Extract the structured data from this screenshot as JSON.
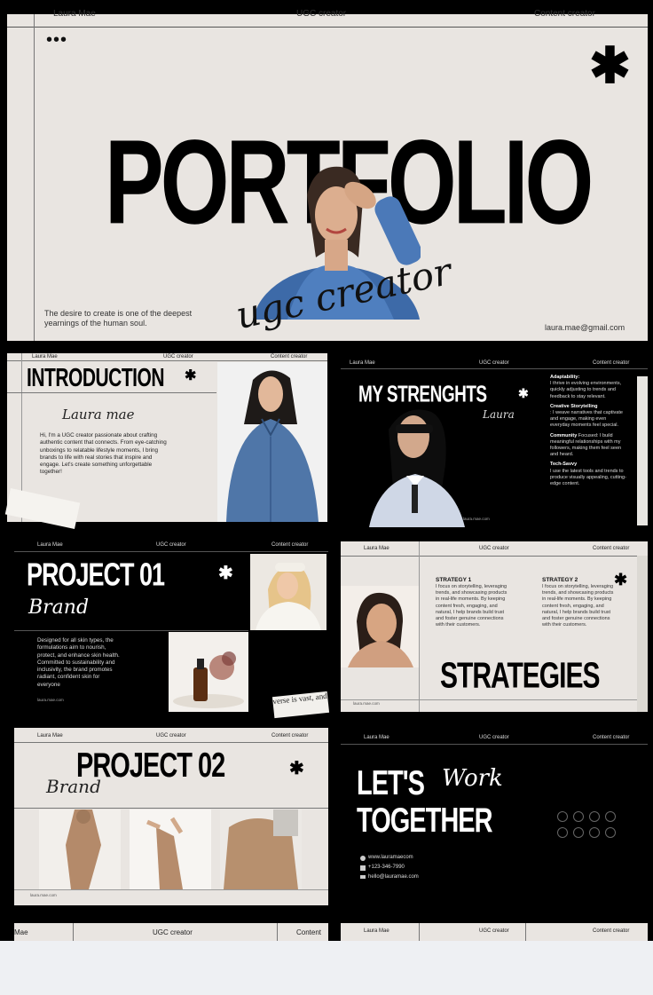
{
  "cover": {
    "header_left": "Laura Mae",
    "header_mid": "UGC creator",
    "header_right": "Content creator",
    "dots": "•••",
    "star": "✱",
    "title": "PORTFOLIO",
    "signature": "ugc creator",
    "tagline": "The desire to create is one of the deepest yearnings of the human soul.",
    "email": "laura.mae@gmail.com"
  },
  "intro": {
    "header_left": "Laura Mae",
    "header_mid": "UGC creator",
    "header_right": "Content creator",
    "title": "INTRODUCTION",
    "star": "✱",
    "signature": "Laura mae",
    "body": "Hi, I'm a UGC creator passionate about crafting authentic content that connects. From eye-catching unboxings to relatable lifestyle moments, I bring brands to life with real stories that inspire and engage. Let's create something unforgettable together!"
  },
  "strengths": {
    "header_left": "Laura Mae",
    "header_mid": "UGC creator",
    "header_right": "Content creator",
    "title": "MY STRENGHTS",
    "star": "✱",
    "signature": "Laura",
    "website": "laura.mae.com",
    "items": [
      {
        "name": "Adaptability:",
        "text": "I thrive in evolving environments, quickly adjusting to trends and feedback to stay relevant."
      },
      {
        "name": "Creative Storytelling",
        "text": ": I weave narratives that captivate and engage, making even everyday moments feel special."
      },
      {
        "name": "Community",
        "text": "Focused: I build meaningful relationships with my followers, making them feel seen and heard."
      },
      {
        "name": "Tech-Savvy",
        "text": "I use the latest tools and trends to produce visually appealing, cutting-edge content."
      }
    ]
  },
  "project1": {
    "header_left": "Laura Mae",
    "header_mid": "UGC creator",
    "header_right": "Content creator",
    "title": "PROJECT 01",
    "star": "✱",
    "signature": "Brand",
    "body": "Designed for all skin types, the formulations aim to nourish, protect, and enhance skin health. Committed to sustainability and inclusivity, the brand promotes radiant, confident skin for everyone",
    "website": "laura.mae.com"
  },
  "strategies": {
    "header_left": "Laura Mae",
    "header_mid": "UGC creator",
    "header_right": "Content creator",
    "title": "STRATEGIES",
    "star": "✱",
    "website": "laura.mae.com",
    "s1_title": "STRATEGY  1",
    "s1_text": "I focus on storytelling, leveraging trends, and showcasing products in real-life moments. By keeping content fresh, engaging, and natural, I help brands build trust and foster genuine connections with their customers.",
    "s2_title": "STRATEGY 2",
    "s2_text": "I focus on storytelling, leveraging trends, and showcasing products in real-life moments. By keeping content fresh, engaging, and natural, I help brands build trust and foster genuine connections with their customers."
  },
  "project2": {
    "header_left": "Laura Mae",
    "header_mid": "UGC creator",
    "header_right": "Content creator",
    "title": "PROJECT 02",
    "star": "✱",
    "signature": "Brand",
    "website": "laura.mae.com"
  },
  "work": {
    "header_left": "Laura Mae",
    "header_mid": "UGC creator",
    "header_right": "Content creator",
    "title1": "LET'S",
    "script": "Work",
    "title2": "TOGETHER",
    "web": "www.lauramaecom",
    "phone": "+123-346-7990",
    "mail": "hello@lauramae.com"
  },
  "bottom": {
    "left_mae": "Mae",
    "left_mid": "UGC creator",
    "left_right": "Content",
    "right_left": "Laura Mae",
    "right_mid": "UGC creator",
    "right_right": "Content creator"
  },
  "collage_text": "verse is vast, and"
}
